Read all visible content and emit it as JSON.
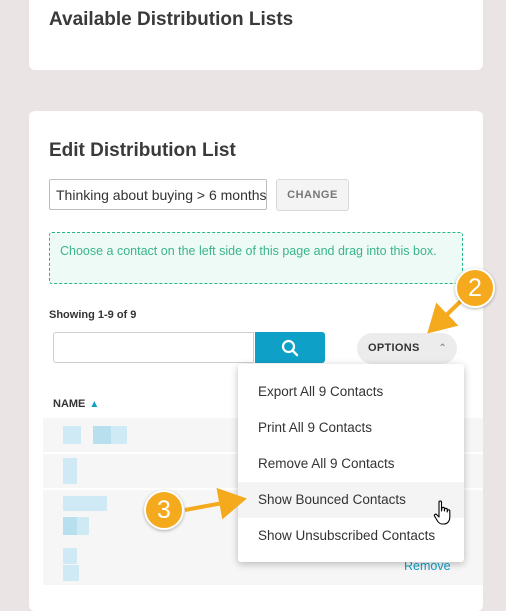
{
  "available_card": {
    "title": "Available Distribution Lists"
  },
  "edit_card": {
    "title": "Edit Distribution List",
    "selected_list": "Thinking about buying > 6 months",
    "change_label": "CHANGE",
    "drop_hint": "Choose a contact on the left side of this page and drag into this box.",
    "showing": "Showing 1-9 of 9",
    "search": {
      "value": "",
      "placeholder": ""
    },
    "options_label": "OPTIONS",
    "name_header": "NAME",
    "remove_label": "Remove"
  },
  "options_menu": {
    "items": [
      "Export All 9 Contacts",
      "Print All 9 Contacts",
      "Remove All 9 Contacts",
      "Show Bounced Contacts",
      "Show Unsubscribed Contacts"
    ],
    "highlighted": "Show Bounced Contacts"
  },
  "callouts": {
    "step2": "2",
    "step3": "3"
  },
  "icons": {
    "search": "search-icon",
    "options_chevron": "chevron-up-icon",
    "sort": "sort-ascending-icon",
    "cursor": "hand-pointer-icon"
  },
  "colors": {
    "accent": "#0fa0c8",
    "drop_zone_text": "#3bb48b",
    "callout": "#f5a91c",
    "page_bg": "#ebe4e4"
  }
}
